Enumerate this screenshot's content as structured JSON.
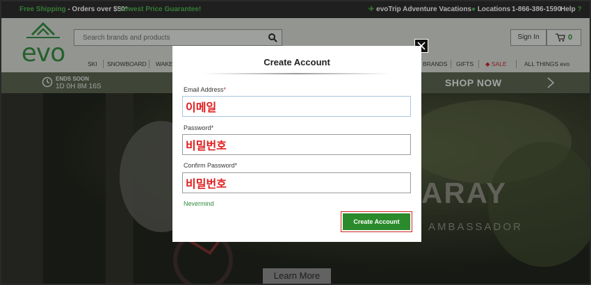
{
  "topbar": {
    "promo_free_shipping": "Free Shipping",
    "promo_orders": " - Orders over $50*",
    "promo_price": "Lowest Price Guarantee!",
    "evotrip": "evoTrip Adventure Vacations",
    "locations": "Locations",
    "phone": "1-866-386-1590",
    "help": "Help"
  },
  "header": {
    "logo_text": "evo",
    "search_placeholder": "Search brands and products",
    "signin_label": "Sign In",
    "cart_count": "0"
  },
  "nav": {
    "items": [
      "SKI",
      "SNOWBOARD",
      "WAKE",
      "BRANDS",
      "GIFTS",
      "SALE",
      "ALL THINGS evo"
    ]
  },
  "promo_bar": {
    "ends_soon": "ENDS SOON",
    "countdown": "1D 0H 8M 16S",
    "shop_now": "SHOP NOW"
  },
  "hero": {
    "title": "ARAY",
    "subtitle": "AMBASSADOR",
    "learn_more": "Learn More"
  },
  "modal": {
    "title": "Create Account",
    "email_label": "Email Address",
    "email_value": "이메일",
    "password_label": "Password",
    "password_value": "비밀번호",
    "confirm_label": "Confirm Password",
    "confirm_value": "비밀번호",
    "required_mark": "*",
    "nevermind": "Nevermind",
    "create_button": "Create Account"
  },
  "colors": {
    "brand_green": "#2e8a3a",
    "button_green": "#2b8a2b",
    "sale_red": "#c0272d"
  }
}
